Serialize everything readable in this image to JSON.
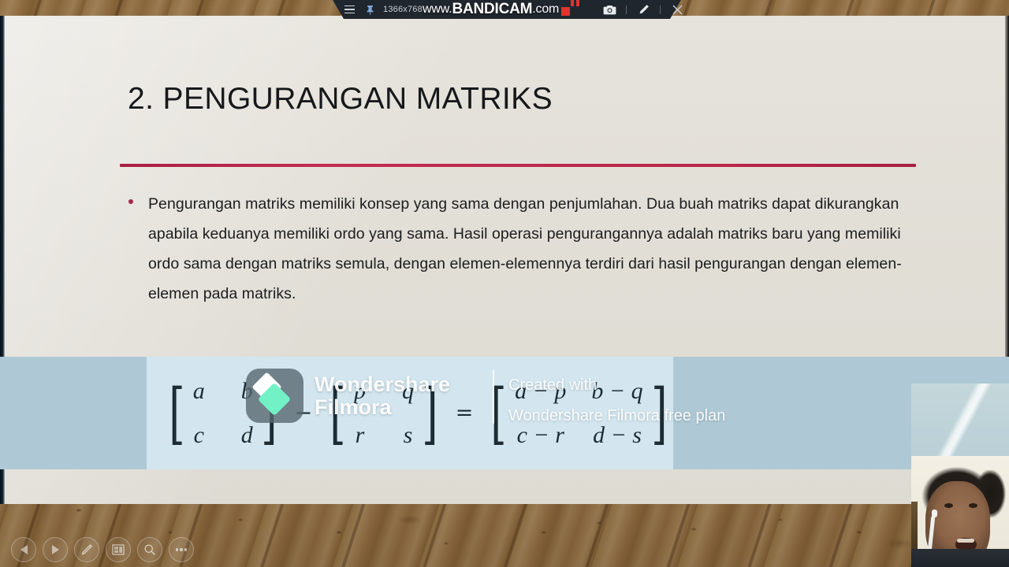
{
  "recorder_bar": {
    "menu_icon": "hamburger-icon",
    "pin_icon": "pin-icon",
    "resolution": "1366x768",
    "capture_icon": "camera-icon",
    "draw_icon": "pencil-icon",
    "close_icon": "close-icon",
    "watermark": {
      "prefix": "www.",
      "brand": "BANDICAM",
      "suffix": ".com"
    }
  },
  "slide": {
    "title": "2. PENGURANGAN MATRIKS",
    "accent_color": "#b52649",
    "background_color": "#e2dfd8",
    "bullet_color": "#a8254a",
    "body": "Pengurangan matriks memiliki konsep yang sama dengan penjumlahan. Dua buah matriks dapat dikurangkan apabila keduanya memiliki ordo yang sama. Hasil operasi pengurangannya adalah matriks baru yang memiliki ordo sama dengan matriks semula, dengan elemen-elemennya terdiri dari hasil pengurangan dengan elemen-elemen pada matriks.",
    "equation": {
      "band_color": "#aec9d5",
      "box_color": "#d3e6ef",
      "matrix_a": {
        "r1c1": "a",
        "r1c2": "b",
        "r2c1": "c",
        "r2c2": "d"
      },
      "operator_minus": "−",
      "matrix_b": {
        "r1c1": "p",
        "r1c2": "q",
        "r2c1": "r",
        "r2c2": "s"
      },
      "operator_equals": "=",
      "matrix_result": {
        "r1c1": "a − p",
        "r1c2": "b − q",
        "r2c1": "c − r",
        "r2c2": "d − s"
      },
      "bracket_open": "[",
      "bracket_close": "]"
    }
  },
  "filmora_watermark": {
    "brand_line1": "Wondershare",
    "brand_line2": "Filmora",
    "notice_line1": "Created with",
    "notice_line2": "Wondershare Filmora free plan",
    "logo_icon": "filmora-logo-icon"
  },
  "presenter_cam": {
    "label": "presenter-webcam"
  },
  "slideshow_toolbar": {
    "buttons": [
      {
        "name": "previous-slide-button",
        "icon": "triangle-left-icon"
      },
      {
        "name": "next-slide-button",
        "icon": "triangle-right-icon"
      },
      {
        "name": "pen-tool-button",
        "icon": "pen-icon"
      },
      {
        "name": "all-slides-button",
        "icon": "grid-slides-icon"
      },
      {
        "name": "zoom-button",
        "icon": "magnifier-icon"
      },
      {
        "name": "more-options-button",
        "icon": "ellipsis-icon"
      }
    ]
  }
}
